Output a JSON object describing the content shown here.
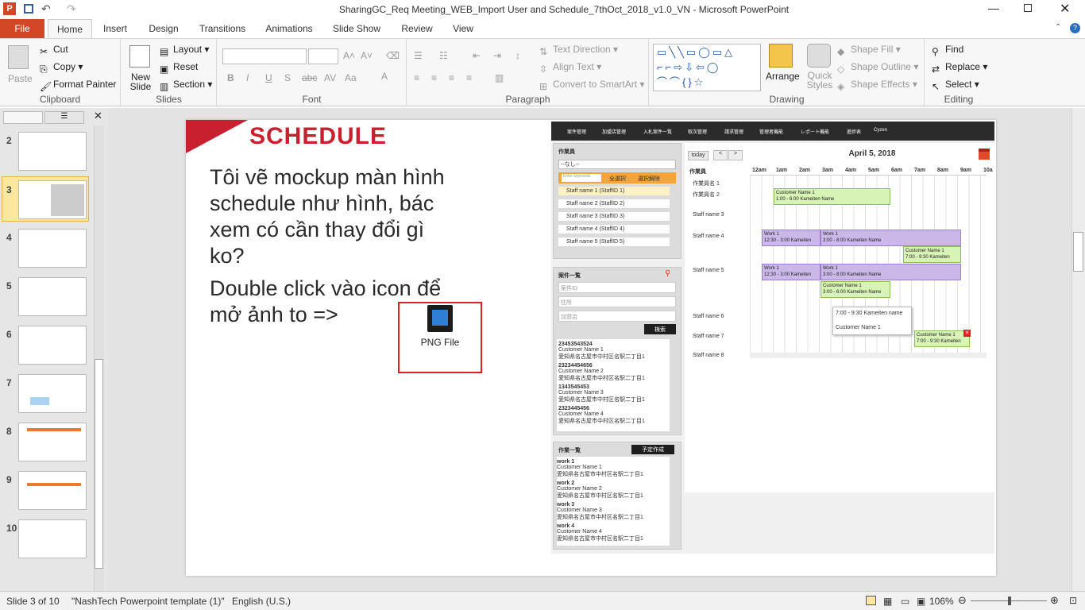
{
  "window": {
    "title": "SharingGC_Req Meeting_WEB_Import User and Schedule_7thOct_2018_v1.0_VN - Microsoft PowerPoint"
  },
  "tabs": [
    "File",
    "Home",
    "Insert",
    "Design",
    "Transitions",
    "Animations",
    "Slide Show",
    "Review",
    "View"
  ],
  "ribbon": {
    "clipboard": {
      "label": "Clipboard",
      "paste": "Paste",
      "cut": "Cut",
      "copy": "Copy",
      "format_painter": "Format Painter"
    },
    "slides": {
      "label": "Slides",
      "new_slide": "New Slide",
      "layout": "Layout",
      "reset": "Reset",
      "section": "Section"
    },
    "font": {
      "label": "Font"
    },
    "paragraph": {
      "label": "Paragraph",
      "text_direction": "Text Direction",
      "align_text": "Align Text",
      "convert": "Convert to SmartArt"
    },
    "drawing": {
      "label": "Drawing",
      "arrange": "Arrange",
      "quick_styles": "Quick Styles",
      "shape_fill": "Shape Fill",
      "shape_outline": "Shape Outline",
      "shape_effects": "Shape Effects"
    },
    "editing": {
      "label": "Editing",
      "find": "Find",
      "replace": "Replace",
      "select": "Select"
    }
  },
  "thumbnails": [
    "2",
    "3",
    "4",
    "5",
    "6",
    "7",
    "8",
    "9",
    "10"
  ],
  "slide": {
    "heading": "SCHEDULE",
    "body1": "Tôi vẽ mockup màn hình schedule như hình, bác xem có cần thay đổi gì ko?",
    "body2": "Double click vào icon để mở ảnh to =>",
    "png_label": "PNG File"
  },
  "mockup": {
    "nav": [
      "案件管理",
      "加盟店管理",
      "入札案件一覧",
      "取次管理",
      "請求管理",
      "管理者機能",
      "レポート機能",
      "進捗表",
      "Cyzen"
    ],
    "staff_panel": {
      "title": "作業員",
      "select": "--なし--",
      "placeholder": "Enter keywords",
      "select_all": "全選択",
      "deselect": "選択解除",
      "staff": [
        "Staff name 1 (StaffID 1)",
        "Staff name 2 (StaffID 2)",
        "Staff name 3 (StaffID 3)",
        "Staff name 4 (StaffID 4)",
        "Staff name 5 (StaffID 5)"
      ]
    },
    "case_panel": {
      "title": "案件一覧",
      "id_ph": "案件ID",
      "addr_ph": "住所",
      "store_ph": "加盟店",
      "search": "検索",
      "items": [
        {
          "id": "23453543524",
          "cust": "Customer Name 1",
          "addr": "愛知県名古屋市中村区名駅二丁目1"
        },
        {
          "id": "23234454656",
          "cust": "Customer Name 2",
          "addr": "愛知県名古屋市中村区名駅二丁目1"
        },
        {
          "id": "1343545453",
          "cust": "Customer Name 3",
          "addr": "愛知県名古屋市中村区名駅二丁目1"
        },
        {
          "id": "2323445456",
          "cust": "Customer Name 4",
          "addr": "愛知県名古屋市中村区名駅二丁目1"
        }
      ]
    },
    "work_panel": {
      "title": "作業一覧",
      "create": "予定作成",
      "items": [
        {
          "id": "work 1",
          "cust": "Customer Name 1",
          "addr": "愛知県名古屋市中村区名駅二丁目1"
        },
        {
          "id": "work 2",
          "cust": "Customer Name 2",
          "addr": "愛知県名古屋市中村区名駅二丁目1"
        },
        {
          "id": "work 3",
          "cust": "Customer Name 3",
          "addr": "愛知県名古屋市中村区名駅二丁目1"
        },
        {
          "id": "work 4",
          "cust": "Customer Name 4",
          "addr": "愛知県名古屋市中村区名駅二丁目1"
        }
      ]
    },
    "calendar": {
      "today": "today",
      "date": "April 5, 2018",
      "col": "作業員",
      "hours": [
        "12am",
        "1am",
        "2am",
        "3am",
        "4am",
        "5am",
        "6am",
        "7am",
        "8am",
        "9am",
        "10a"
      ],
      "rows": [
        "作業員名 1",
        "作業員名 2",
        "Staff name 3",
        "Staff name 4",
        "Staff name 5",
        "Staff name 6",
        "Staff name 7",
        "Staff name 8"
      ],
      "events": {
        "e1": {
          "t": "Customer Name 1",
          "d": "1:00 - 6:00 Kameiten Name"
        },
        "e2": {
          "t": "Work 1",
          "d": "12:30 - 3:00 Kameiten"
        },
        "e3": {
          "t": "Work 1",
          "d": "3:00 - 8:00 Kameiten Name"
        },
        "e4": {
          "t": "Customer Name 1",
          "d": "7:00 - 9:30 Kameiten"
        },
        "e5": {
          "t": "Work 1",
          "d": "12:30 - 3:00 Kameiten"
        },
        "e6": {
          "t": "Work 1",
          "d": "3:00 - 8:00 Kameiten Name"
        },
        "e7": {
          "t": "Customer Name 1",
          "d": "3:00 - 6:00 Kameiten Name"
        },
        "e8": {
          "t": "Customer Name 1",
          "d": "7:00 - 9:30 Kameiten"
        }
      },
      "popup": {
        "l1": "7:00 - 9:30 Kameiten name",
        "l2": "Customer Name 1"
      }
    }
  },
  "status": {
    "slide": "Slide 3 of 10",
    "template": "\"NashTech Powerpoint template (1)\"",
    "lang": "English (U.S.)",
    "zoom": "106%"
  },
  "colors": {
    "file_tab": "#d24726",
    "accent": "#c8202f"
  }
}
